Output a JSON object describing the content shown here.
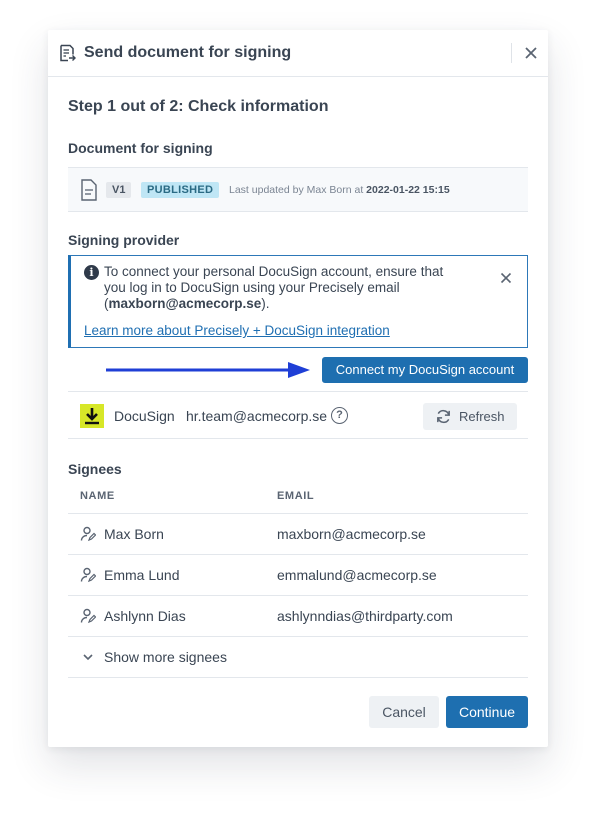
{
  "dialog": {
    "title": "Send document for signing",
    "close_icon": "close-icon"
  },
  "step": {
    "title": "Step 1 out of 2: Check information"
  },
  "document": {
    "section_label": "Document for signing",
    "version": "V1",
    "status": "PUBLISHED",
    "meta_prefix": "Last updated by Max Born at ",
    "meta_date": "2022-01-22 15:15"
  },
  "signing_provider": {
    "section_label": "Signing provider",
    "info": {
      "text_before": "To connect your personal DocuSign account, ensure that you log in to DocuSign using your Precisely email (",
      "email": "maxborn@acmecorp.se",
      "text_after": ").",
      "link": "Learn more about Precisely + DocuSign integration"
    },
    "connect_button": "Connect my DocuSign account",
    "provider_name": "DocuSign",
    "provider_email": "hr.team@acmecorp.se",
    "help_glyph": "?",
    "refresh_label": "Refresh",
    "accent_color": "#1e6fb0",
    "logo_color": "#d7e728"
  },
  "signees": {
    "section_label": "Signees",
    "columns": [
      "NAME",
      "EMAIL"
    ],
    "rows": [
      {
        "name": "Max Born",
        "email": "maxborn@acmecorp.se"
      },
      {
        "name": "Emma Lund",
        "email": "emmalund@acmecorp.se"
      },
      {
        "name": "Ashlynn Dias",
        "email": "ashlynndias@thirdparty.com"
      }
    ],
    "show_more": "Show more signees"
  },
  "footer": {
    "cancel": "Cancel",
    "continue": "Continue"
  }
}
